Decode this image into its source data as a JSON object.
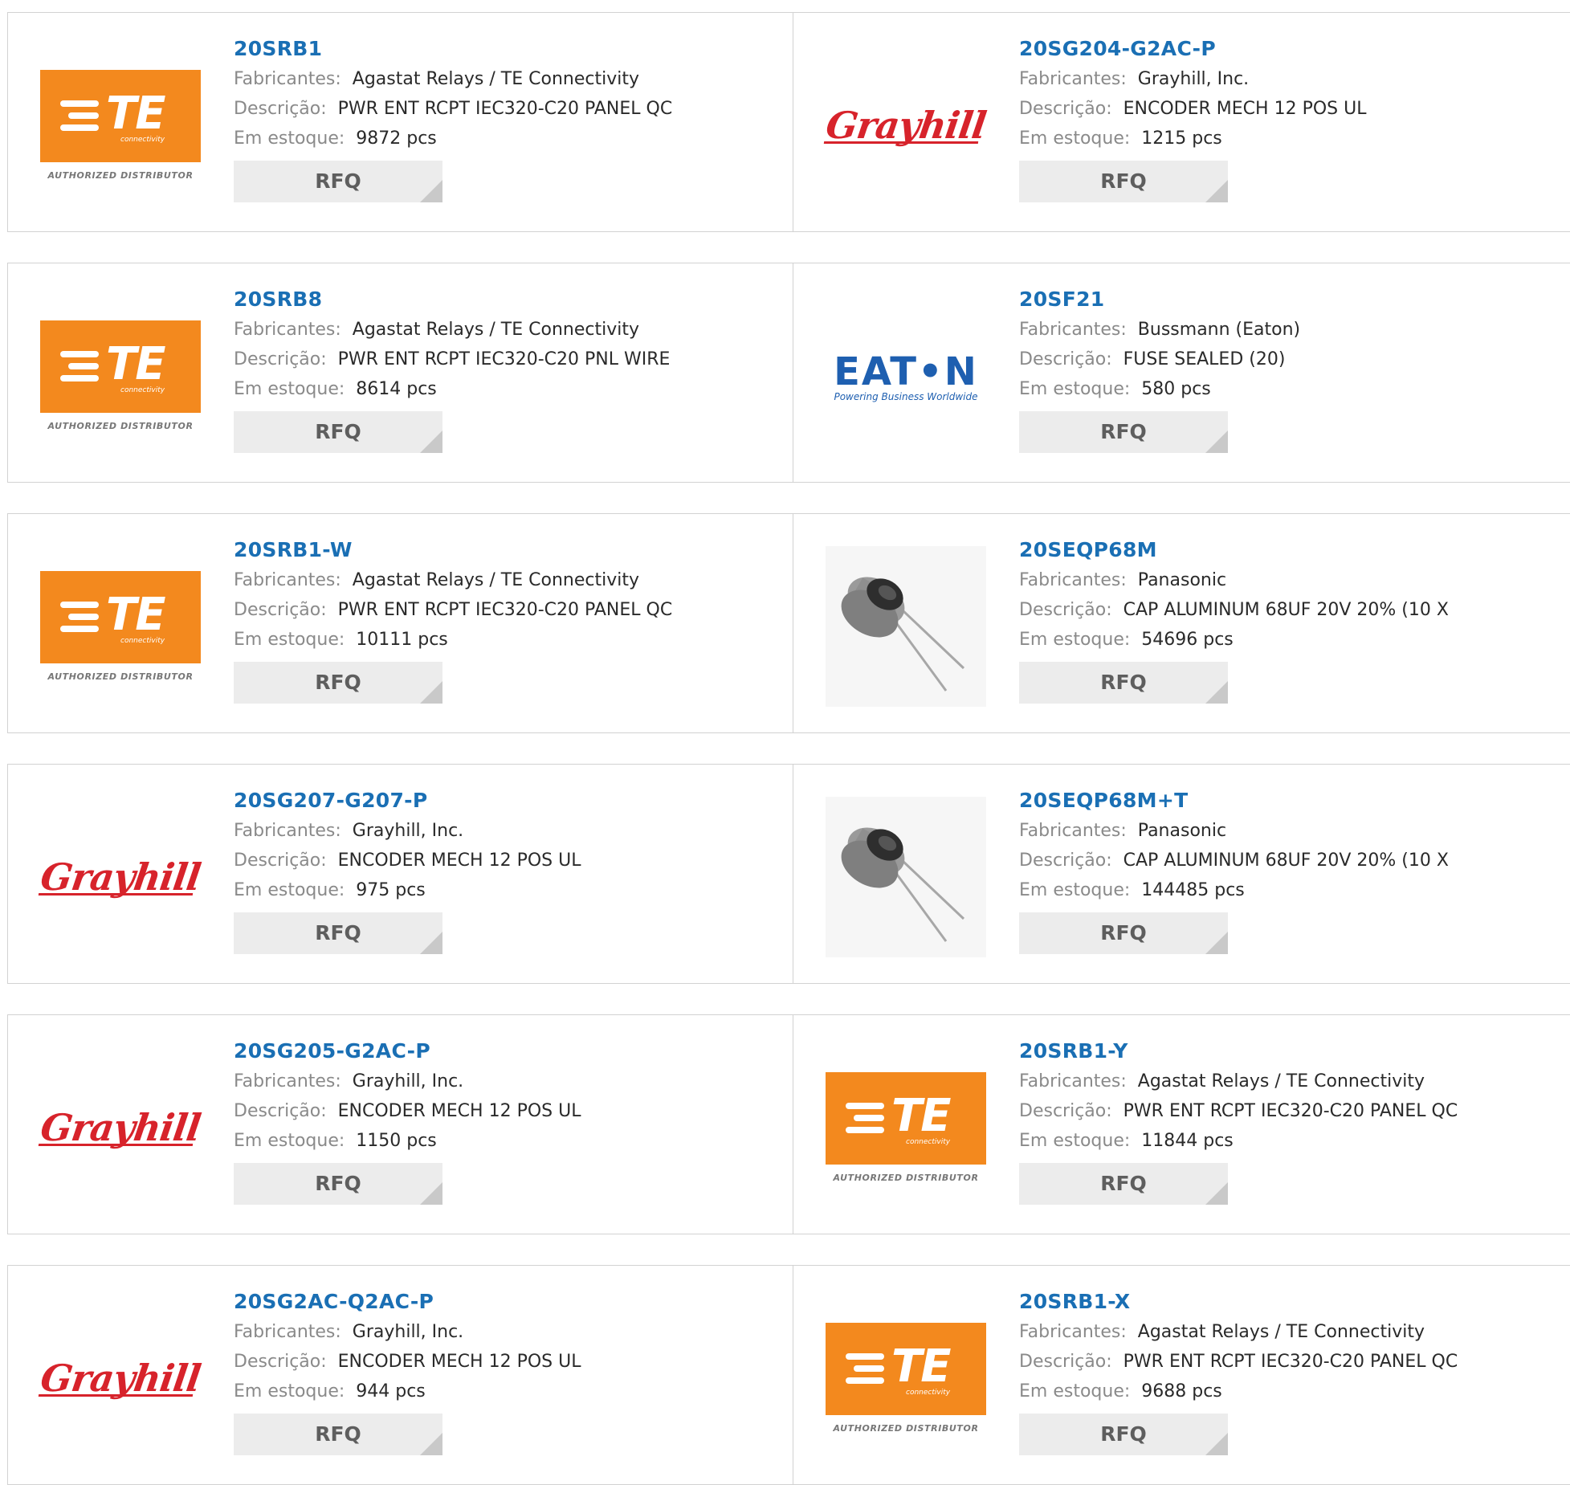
{
  "labels": {
    "manufacturer": "Fabricantes:",
    "description": "Descrição:",
    "stock": "Em estoque:",
    "rfq": "RFQ"
  },
  "logos": {
    "te_tagline": "connectivity",
    "te_authorized": "AUTHORIZED DISTRIBUTOR",
    "grayhill_text": "Grayhill",
    "eaton_text": "EAT•N",
    "eaton_tagline": "Powering Business Worldwide"
  },
  "colors": {
    "part_number": "#1a6fb4",
    "te_orange": "#f3891e",
    "grayhill_red": "#d7232b",
    "eaton_blue": "#1e5fb0",
    "rfq_bg": "#ececec"
  },
  "products": [
    [
      {
        "part": "20SRB1",
        "logo": "te-logo",
        "manufacturer": "Agastat Relays / TE Connectivity",
        "description": "PWR ENT RCPT IEC320-C20 PANEL QC",
        "stock": "9872 pcs"
      },
      {
        "part": "20SG204-G2AC-P",
        "logo": "grayhill-logo",
        "manufacturer": "Grayhill, Inc.",
        "description": "ENCODER MECH 12 POS UL",
        "stock": "1215 pcs"
      }
    ],
    [
      {
        "part": "20SRB8",
        "logo": "te-logo",
        "manufacturer": "Agastat Relays / TE Connectivity",
        "description": "PWR ENT RCPT IEC320-C20 PNL WIRE",
        "stock": "8614 pcs"
      },
      {
        "part": "20SF21",
        "logo": "eaton-logo",
        "manufacturer": "Bussmann (Eaton)",
        "description": "FUSE SEALED (20)",
        "stock": "580 pcs"
      }
    ],
    [
      {
        "part": "20SRB1-W",
        "logo": "te-logo",
        "manufacturer": "Agastat Relays / TE Connectivity",
        "description": "PWR ENT RCPT IEC320-C20 PANEL QC",
        "stock": "10111 pcs"
      },
      {
        "part": "20SEQP68M",
        "logo": "capacitor-image",
        "manufacturer": "Panasonic",
        "description": "CAP ALUMINUM 68UF 20V 20% (10 X",
        "stock": "54696 pcs"
      }
    ],
    [
      {
        "part": "20SG207-G207-P",
        "logo": "grayhill-logo",
        "manufacturer": "Grayhill, Inc.",
        "description": "ENCODER MECH 12 POS UL",
        "stock": "975 pcs"
      },
      {
        "part": "20SEQP68M+T",
        "logo": "capacitor-image",
        "manufacturer": "Panasonic",
        "description": "CAP ALUMINUM 68UF 20V 20% (10 X",
        "stock": "144485 pcs"
      }
    ],
    [
      {
        "part": "20SG205-G2AC-P",
        "logo": "grayhill-logo",
        "manufacturer": "Grayhill, Inc.",
        "description": "ENCODER MECH 12 POS UL",
        "stock": "1150 pcs"
      },
      {
        "part": "20SRB1-Y",
        "logo": "te-logo",
        "manufacturer": "Agastat Relays / TE Connectivity",
        "description": "PWR ENT RCPT IEC320-C20 PANEL QC",
        "stock": "11844 pcs"
      }
    ],
    [
      {
        "part": "20SG2AC-Q2AC-P",
        "logo": "grayhill-logo",
        "manufacturer": "Grayhill, Inc.",
        "description": "ENCODER MECH 12 POS UL",
        "stock": "944 pcs"
      },
      {
        "part": "20SRB1-X",
        "logo": "te-logo",
        "manufacturer": "Agastat Relays / TE Connectivity",
        "description": "PWR ENT RCPT IEC320-C20 PANEL QC",
        "stock": "9688 pcs"
      }
    ]
  ]
}
